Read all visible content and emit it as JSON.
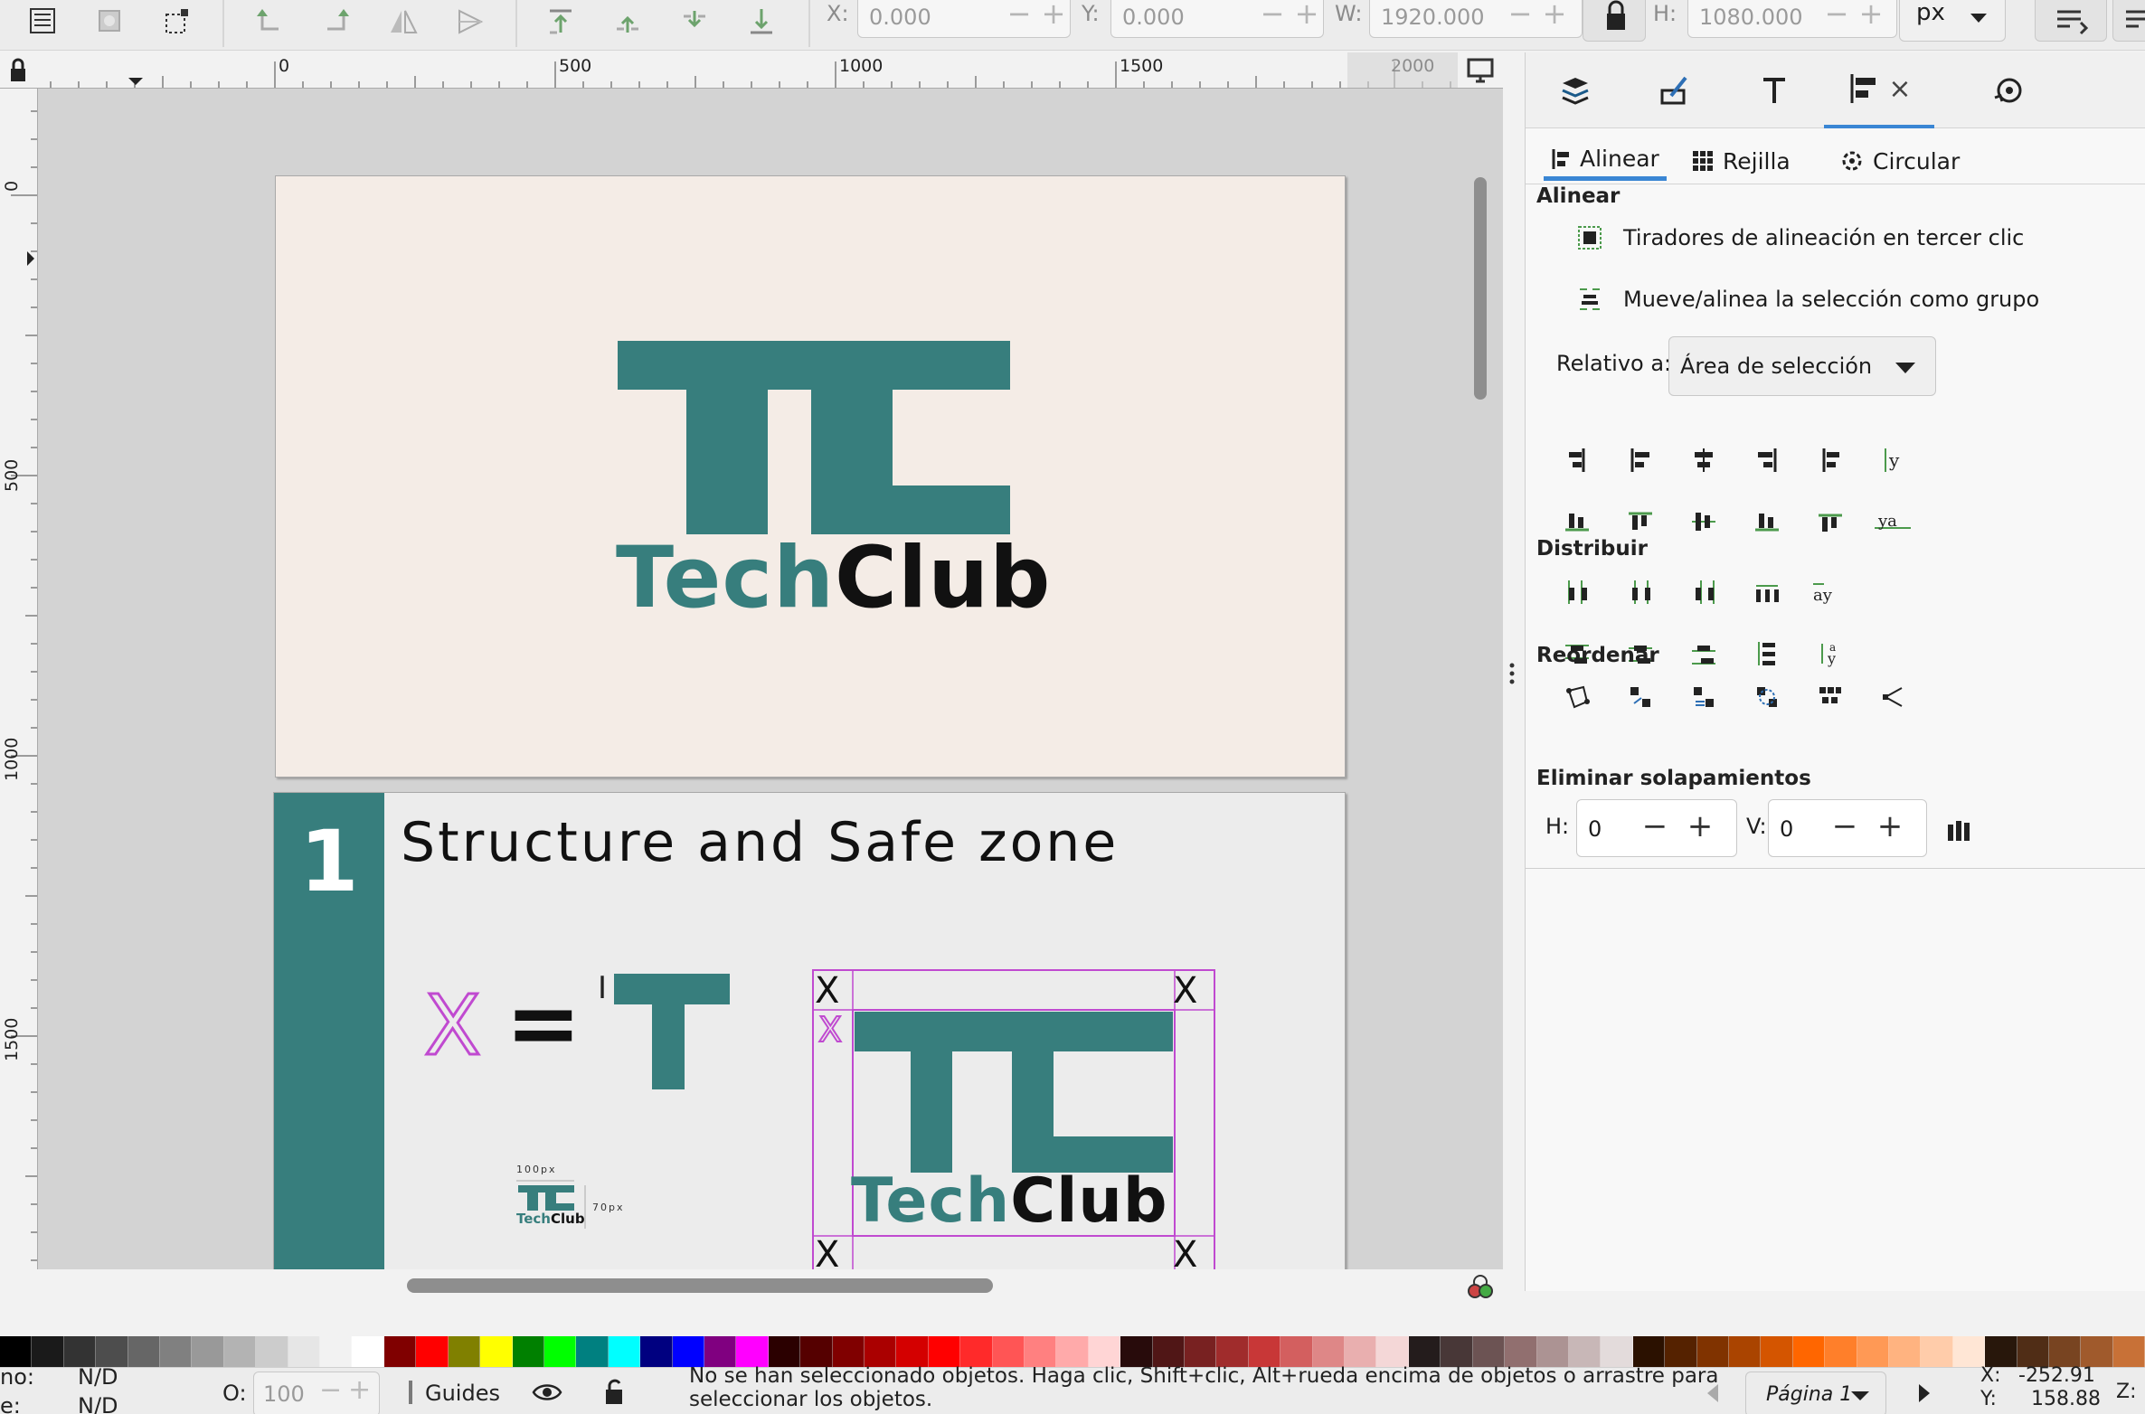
{
  "toolbar": {
    "x_label": "X:",
    "x_value": "0.000",
    "y_label": "Y:",
    "y_value": "0.000",
    "w_label": "W:",
    "w_value": "1920.000",
    "h_label": "H:",
    "h_value": "1080.000",
    "unit": "px",
    "minus": "−",
    "plus": "+"
  },
  "ruler": {
    "top_ticks": [
      "0",
      "500",
      "1000",
      "1500",
      "2000"
    ],
    "left_ticks": [
      "0",
      "500",
      "1000",
      "1500"
    ]
  },
  "canvas": {
    "page1": {
      "logo_part1": "Tech",
      "logo_part2": "Club"
    },
    "page2": {
      "number": "1",
      "heading": "Structure and Safe zone",
      "x_symbol": "X",
      "equals": "=",
      "mini_width_label": "100px",
      "mini_height_label": "70px",
      "mini_logo_part1": "Tech",
      "mini_logo_part2": "Club",
      "corner_marker": "X",
      "logo_part1": "Tech",
      "logo_part2": "Club"
    },
    "colors": {
      "teal": "#377e7d",
      "magenta": "#c04ad0",
      "page_bg": "#f4ece6"
    }
  },
  "panel": {
    "tabs": [
      "layers-icon",
      "fill-stroke-icon",
      "text-icon",
      "align-icon",
      "transform-icon"
    ],
    "close": "×",
    "subtabs": [
      "Alinear",
      "Rejilla",
      "Circular"
    ],
    "align_title": "Alinear",
    "option1": "Tiradores de alineación en tercer clic",
    "option2": "Mueve/alinea la selección como grupo",
    "relative_label": "Relativo a:",
    "relative_value": "Área de selección",
    "distribute_title": "Distribuir",
    "reorder_title": "Reordenar",
    "overlap_title": "Eliminar solapamientos",
    "h_label": "H:",
    "h_value": "0",
    "v_label": "V:",
    "v_value": "0",
    "glyph_ay": "ay",
    "glyph_ya": "ya"
  },
  "status": {
    "fill_label": "no:",
    "fill_value": "N/D",
    "stroke_label": "e:",
    "stroke_value": "N/D",
    "opacity_label": "O:",
    "opacity_value": "100",
    "layer_name": "Guides",
    "message_line1": "No se han seleccionado objetos. Haga clic, Shift+clic, Alt+rueda encima de objetos o arrastre para",
    "message_line2": "seleccionar los objetos.",
    "page_label": "Página 1",
    "cursor_x_label": "X:",
    "cursor_x": "-252.91",
    "cursor_y_label": "Y:",
    "cursor_y": "158.88",
    "zoom_label": "Z:"
  },
  "palette": [
    "#000000",
    "#1a1a1a",
    "#333333",
    "#4d4d4d",
    "#666666",
    "#808080",
    "#999999",
    "#b3b3b3",
    "#cccccc",
    "#e6e6e6",
    "#f2f2f2",
    "#ffffff",
    "#800000",
    "#ff0000",
    "#808000",
    "#ffff00",
    "#008000",
    "#00ff00",
    "#008080",
    "#00ffff",
    "#000080",
    "#0000ff",
    "#800080",
    "#ff00ff",
    "#2b0000",
    "#550000",
    "#800000",
    "#aa0000",
    "#d40000",
    "#ff0000",
    "#ff2a2a",
    "#ff5555",
    "#ff8080",
    "#ffaaaa",
    "#ffd5d5",
    "#280b0b",
    "#501616",
    "#782121",
    "#a02c2c",
    "#c83737",
    "#d35f5f",
    "#de8787",
    "#e9afaf",
    "#f4d7d7",
    "#241c1c",
    "#483737",
    "#6c5353",
    "#916f6f",
    "#ac9393",
    "#c8b7b7",
    "#e3dbdb",
    "#2b1100",
    "#552200",
    "#803300",
    "#aa4400",
    "#d45500",
    "#ff6600",
    "#ff7f2a",
    "#ff9955",
    "#ffb380",
    "#ffccaa",
    "#ffe6d5",
    "#28170b",
    "#502d16",
    "#784421",
    "#a05a2c",
    "#c87137"
  ]
}
